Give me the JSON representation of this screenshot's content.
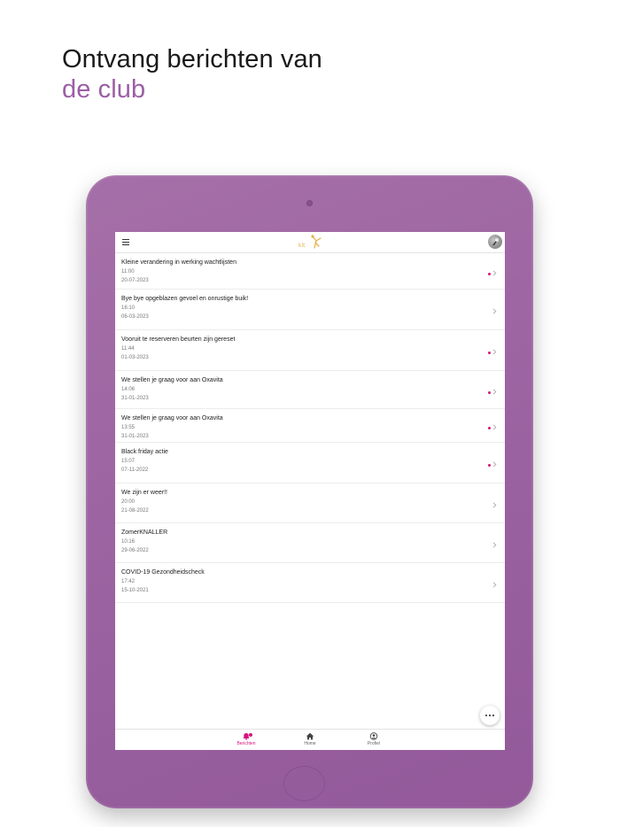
{
  "headline": {
    "line1": "Ontvang berichten van",
    "line2": "de club"
  },
  "app": {
    "messages": [
      {
        "title": "Kleine verandering in werking wachtlijsten",
        "time": "11:00",
        "date": "20-07-2023",
        "unread": true
      },
      {
        "title": "Bye bye opgeblazen gevoel en onrustige buik!",
        "time": "16:10",
        "date": "06-03-2023",
        "unread": false
      },
      {
        "title": "Vooruit te reserveren beurten zijn gereset",
        "time": "11:44",
        "date": "01-03-2023",
        "unread": true
      },
      {
        "title": "We stellen je graag voor aan Oxavita",
        "time": "14:06",
        "date": "31-01-2023",
        "unread": true
      },
      {
        "title": "We stellen je graag voor aan Oxavita",
        "time": "13:55",
        "date": "31-01-2023",
        "unread": true
      },
      {
        "title": "Black friday actie",
        "time": "15:07",
        "date": "07-11-2022",
        "unread": true
      },
      {
        "title": "We zijn er weer!!",
        "time": "20:00",
        "date": "21-08-2022",
        "unread": false
      },
      {
        "title": "ZomerKNALLER",
        "time": "10:16",
        "date": "29-06-2022",
        "unread": false
      },
      {
        "title": "COVID-19 Gezondheidscheck",
        "time": "17:42",
        "date": "15-10-2021",
        "unread": false
      }
    ],
    "tabs": [
      {
        "label": "Berichten",
        "icon": "bell-icon",
        "active": true
      },
      {
        "label": "Home",
        "icon": "home-icon",
        "active": false
      },
      {
        "label": "Profiel",
        "icon": "profile-icon",
        "active": false
      }
    ],
    "colors": {
      "accent": "#d6147e",
      "brand_purple": "#9b5ea5",
      "logo_gold": "#e3b04b"
    }
  }
}
